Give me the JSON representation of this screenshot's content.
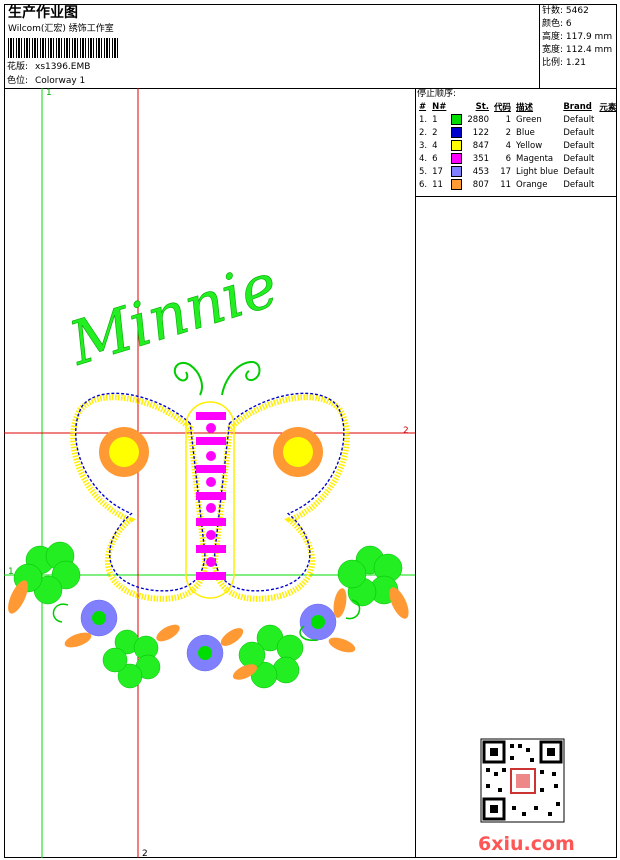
{
  "header": {
    "title": "生产作业图",
    "subtitle": "Wilcom(汇宏) 绣饰工作室",
    "file_label": "花版:",
    "file_value": "xs1396.EMB",
    "colorway_label": "色位:",
    "colorway_value": "Colorway 1"
  },
  "stats": [
    {
      "label": "针数:",
      "value": "5462"
    },
    {
      "label": "颜色:",
      "value": "6"
    },
    {
      "label": "高度:",
      "value": "117.9 mm"
    },
    {
      "label": "宽度:",
      "value": "112.4 mm"
    },
    {
      "label": "比例:",
      "value": "1.21"
    }
  ],
  "stop_sequence": {
    "heading": "停止顺序:",
    "columns": [
      "#",
      "N#",
      "St.",
      "代码",
      "描述",
      "Brand",
      "元素"
    ],
    "rows": [
      {
        "num": "1.",
        "n": "1",
        "color": "#00dd00",
        "st": "2880",
        "code": "1",
        "desc": "Green",
        "brand": "Default",
        "element": ""
      },
      {
        "num": "2.",
        "n": "2",
        "color": "#0000cc",
        "st": "122",
        "code": "2",
        "desc": "Blue",
        "brand": "Default",
        "element": ""
      },
      {
        "num": "3.",
        "n": "4",
        "color": "#ffff00",
        "st": "847",
        "code": "4",
        "desc": "Yellow",
        "brand": "Default",
        "element": ""
      },
      {
        "num": "4.",
        "n": "6",
        "color": "#ff00ff",
        "st": "351",
        "code": "6",
        "desc": "Magenta",
        "brand": "Default",
        "element": ""
      },
      {
        "num": "5.",
        "n": "17",
        "color": "#8080ff",
        "st": "453",
        "code": "17",
        "desc": "Light blue",
        "brand": "Default",
        "element": ""
      },
      {
        "num": "6.",
        "n": "11",
        "color": "#ff9933",
        "st": "807",
        "code": "11",
        "desc": "Orange",
        "brand": "Default",
        "element": ""
      }
    ]
  },
  "design": {
    "text": "Minnie",
    "guide_labels": {
      "top1": "1",
      "right2": "2",
      "left1": "1",
      "bottom2": "2"
    }
  },
  "watermark": "6xiu.com",
  "colors": {
    "green": "#00dd00",
    "red": "#dd0000",
    "yellow": "#ffff00",
    "orange": "#ff9933",
    "blue": "#0000cc",
    "magenta": "#ff00ff",
    "lightblue": "#8080ff"
  }
}
